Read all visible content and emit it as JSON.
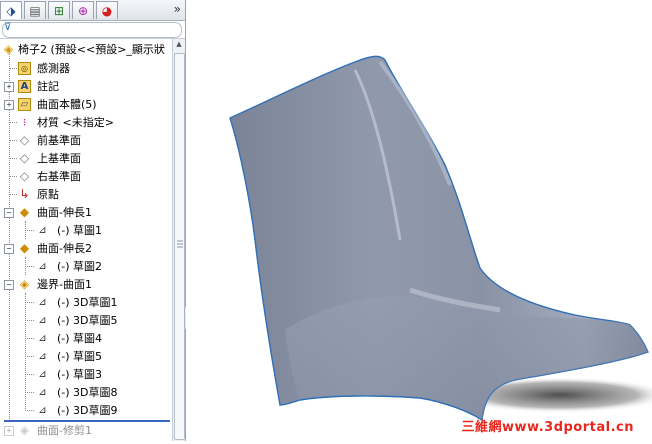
{
  "tabs": [
    {
      "name": "featuremanager",
      "icon": "feature-tree-icon",
      "glyph": "⬗"
    },
    {
      "name": "propertymanager",
      "icon": "property-manager-icon",
      "glyph": "▤"
    },
    {
      "name": "configurationmanager",
      "icon": "configuration-icon",
      "glyph": "⊞"
    },
    {
      "name": "dimxpert",
      "icon": "dimxpert-icon",
      "glyph": "⊕"
    },
    {
      "name": "display",
      "icon": "display-manager-icon",
      "glyph": "◕"
    }
  ],
  "tab_more": "»",
  "filter": {
    "icon": "filter-icon",
    "glyph": "⊽"
  },
  "tree": {
    "root": "椅子2 (預設<<預設>_顯示狀",
    "items": [
      {
        "label": "感測器"
      },
      {
        "label": "註記"
      },
      {
        "label": "曲面本體(5)"
      },
      {
        "label": "材質 <未指定>"
      },
      {
        "label": "前基準面"
      },
      {
        "label": "上基準面"
      },
      {
        "label": "右基準面"
      },
      {
        "label": "原點"
      },
      {
        "label": "曲面-伸長1"
      },
      {
        "label": "(-) 草圖1"
      },
      {
        "label": "曲面-伸長2"
      },
      {
        "label": "(-) 草圖2"
      },
      {
        "label": "邊界-曲面1"
      },
      {
        "label": "(-) 3D草圖1"
      },
      {
        "label": "(-) 3D草圖5"
      },
      {
        "label": "(-) 草圖4"
      },
      {
        "label": "(-) 草圖5"
      },
      {
        "label": "(-) 草圖3"
      },
      {
        "label": "(-) 3D草圖8"
      },
      {
        "label": "(-) 3D草圖9"
      },
      {
        "label": "曲面-修剪1"
      }
    ]
  },
  "watermark": "三維網www.3dportal.cn",
  "colors": {
    "surface": "#8d95a9",
    "surface_edge": "#2f6fb7",
    "accent": "#3a66c4",
    "watermark": "#e8281e"
  }
}
